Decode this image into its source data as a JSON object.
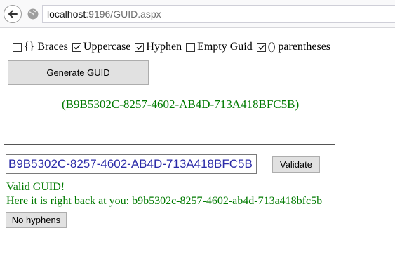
{
  "browser": {
    "url_host": "localhost",
    "url_rest": ":9196/GUID.aspx"
  },
  "options": [
    {
      "label": "{} Braces",
      "checked": false
    },
    {
      "label": "Uppercase",
      "checked": true
    },
    {
      "label": "Hyphen",
      "checked": true
    },
    {
      "label": "Empty Guid",
      "checked": false
    },
    {
      "label": "() parentheses",
      "checked": true
    }
  ],
  "generate_button": "Generate GUID",
  "generated_guid": "(B9B5302C-8257-4602-AB4D-713A418BFC5B)",
  "validator": {
    "input_value": "B9B5302C-8257-4602-AB4D-713A418BFC5B",
    "validate_button": "Validate",
    "valid_message": "Valid GUID!",
    "echo_message": "Here it is right back at you: b9b5302c-8257-4602-ab4d-713a418bfc5b",
    "no_hyphens_button": "No hyphens"
  },
  "colors": {
    "success": "#007a00",
    "input_text": "#2b2ba8"
  }
}
